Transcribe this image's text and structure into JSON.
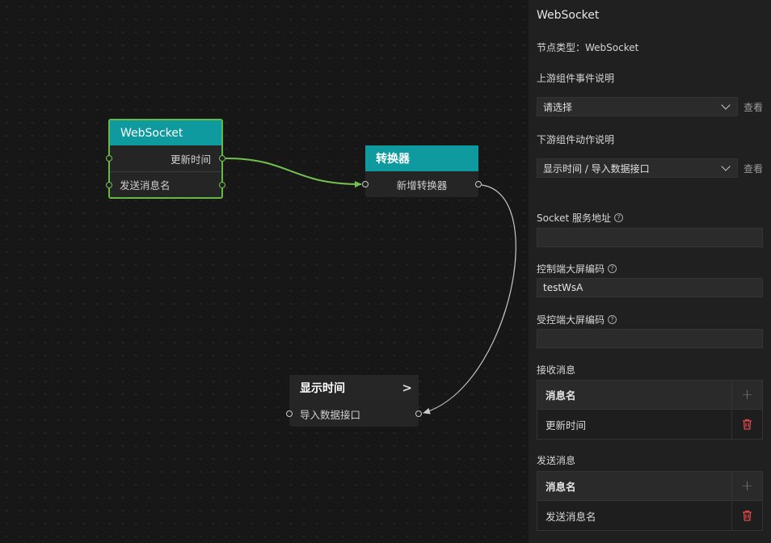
{
  "canvas": {
    "nodes": {
      "websocket": {
        "title": "WebSocket",
        "out_label": "更新时间",
        "in_label": "发送消息名"
      },
      "converter": {
        "title": "转换器",
        "row_label": "新增转换器"
      },
      "display_time": {
        "title": "显示时间",
        "row_label": "导入数据接口",
        "chevron": ">"
      }
    },
    "colors": {
      "header": "#0e9a9e",
      "selected_border": "#67b847",
      "edge_active": "#73c04f",
      "edge": "#c8c8c8"
    }
  },
  "panel": {
    "title": "WebSocket",
    "node_type_label": "节点类型：WebSocket",
    "upstream_label": "上游组件事件说明",
    "upstream_value": "请选择",
    "upstream_link": "查看",
    "downstream_label": "下游组件动作说明",
    "downstream_value": "显示时间 / 导入数据接口",
    "downstream_link": "查看",
    "socket_label": "Socket 服务地址",
    "socket_value": "",
    "control_label": "控制端大屏编码",
    "control_value": "testWsA",
    "controlled_label": "受控端大屏编码",
    "controlled_value": "",
    "help_glyph": "?",
    "receive": {
      "label": "接收消息",
      "header": "消息名",
      "rows": [
        "更新时间"
      ]
    },
    "send": {
      "label": "发送消息",
      "header": "消息名",
      "rows": [
        "发送消息名"
      ]
    },
    "add_glyph": "+",
    "icons": {
      "add": "plus-icon",
      "delete": "trash-icon",
      "dropdown": "chevron-down-icon",
      "help": "question-circle-icon"
    },
    "delete_color": "#e04b4b"
  }
}
